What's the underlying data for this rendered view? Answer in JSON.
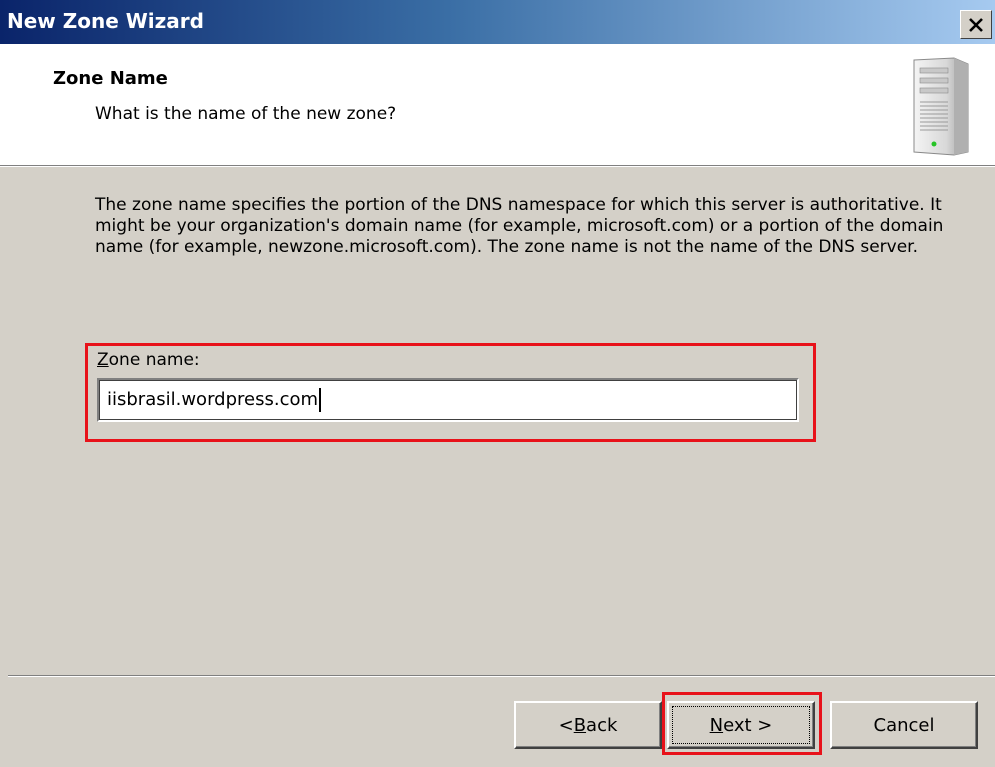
{
  "window": {
    "title": "New Zone Wizard",
    "close_label": "X"
  },
  "header": {
    "title": "Zone Name",
    "subtitle": "What is the name of the new zone?",
    "icon": "server-icon"
  },
  "body": {
    "description": "The zone name specifies the portion of the DNS namespace for which this server is authoritative. It might be your organization's domain name (for example,  microsoft.com) or a portion of the domain name (for example, newzone.microsoft.com). The zone name is not the name of the DNS server.",
    "zone_name_label_accel": "Z",
    "zone_name_label_rest": "one name:",
    "zone_name_value": "iisbrasil.wordpress.com"
  },
  "buttons": {
    "back_prefix": "< ",
    "back_accel": "B",
    "back_rest": "ack",
    "next_accel": "N",
    "next_rest": "ext >",
    "cancel": "Cancel"
  },
  "highlight_color": "#e8121a"
}
